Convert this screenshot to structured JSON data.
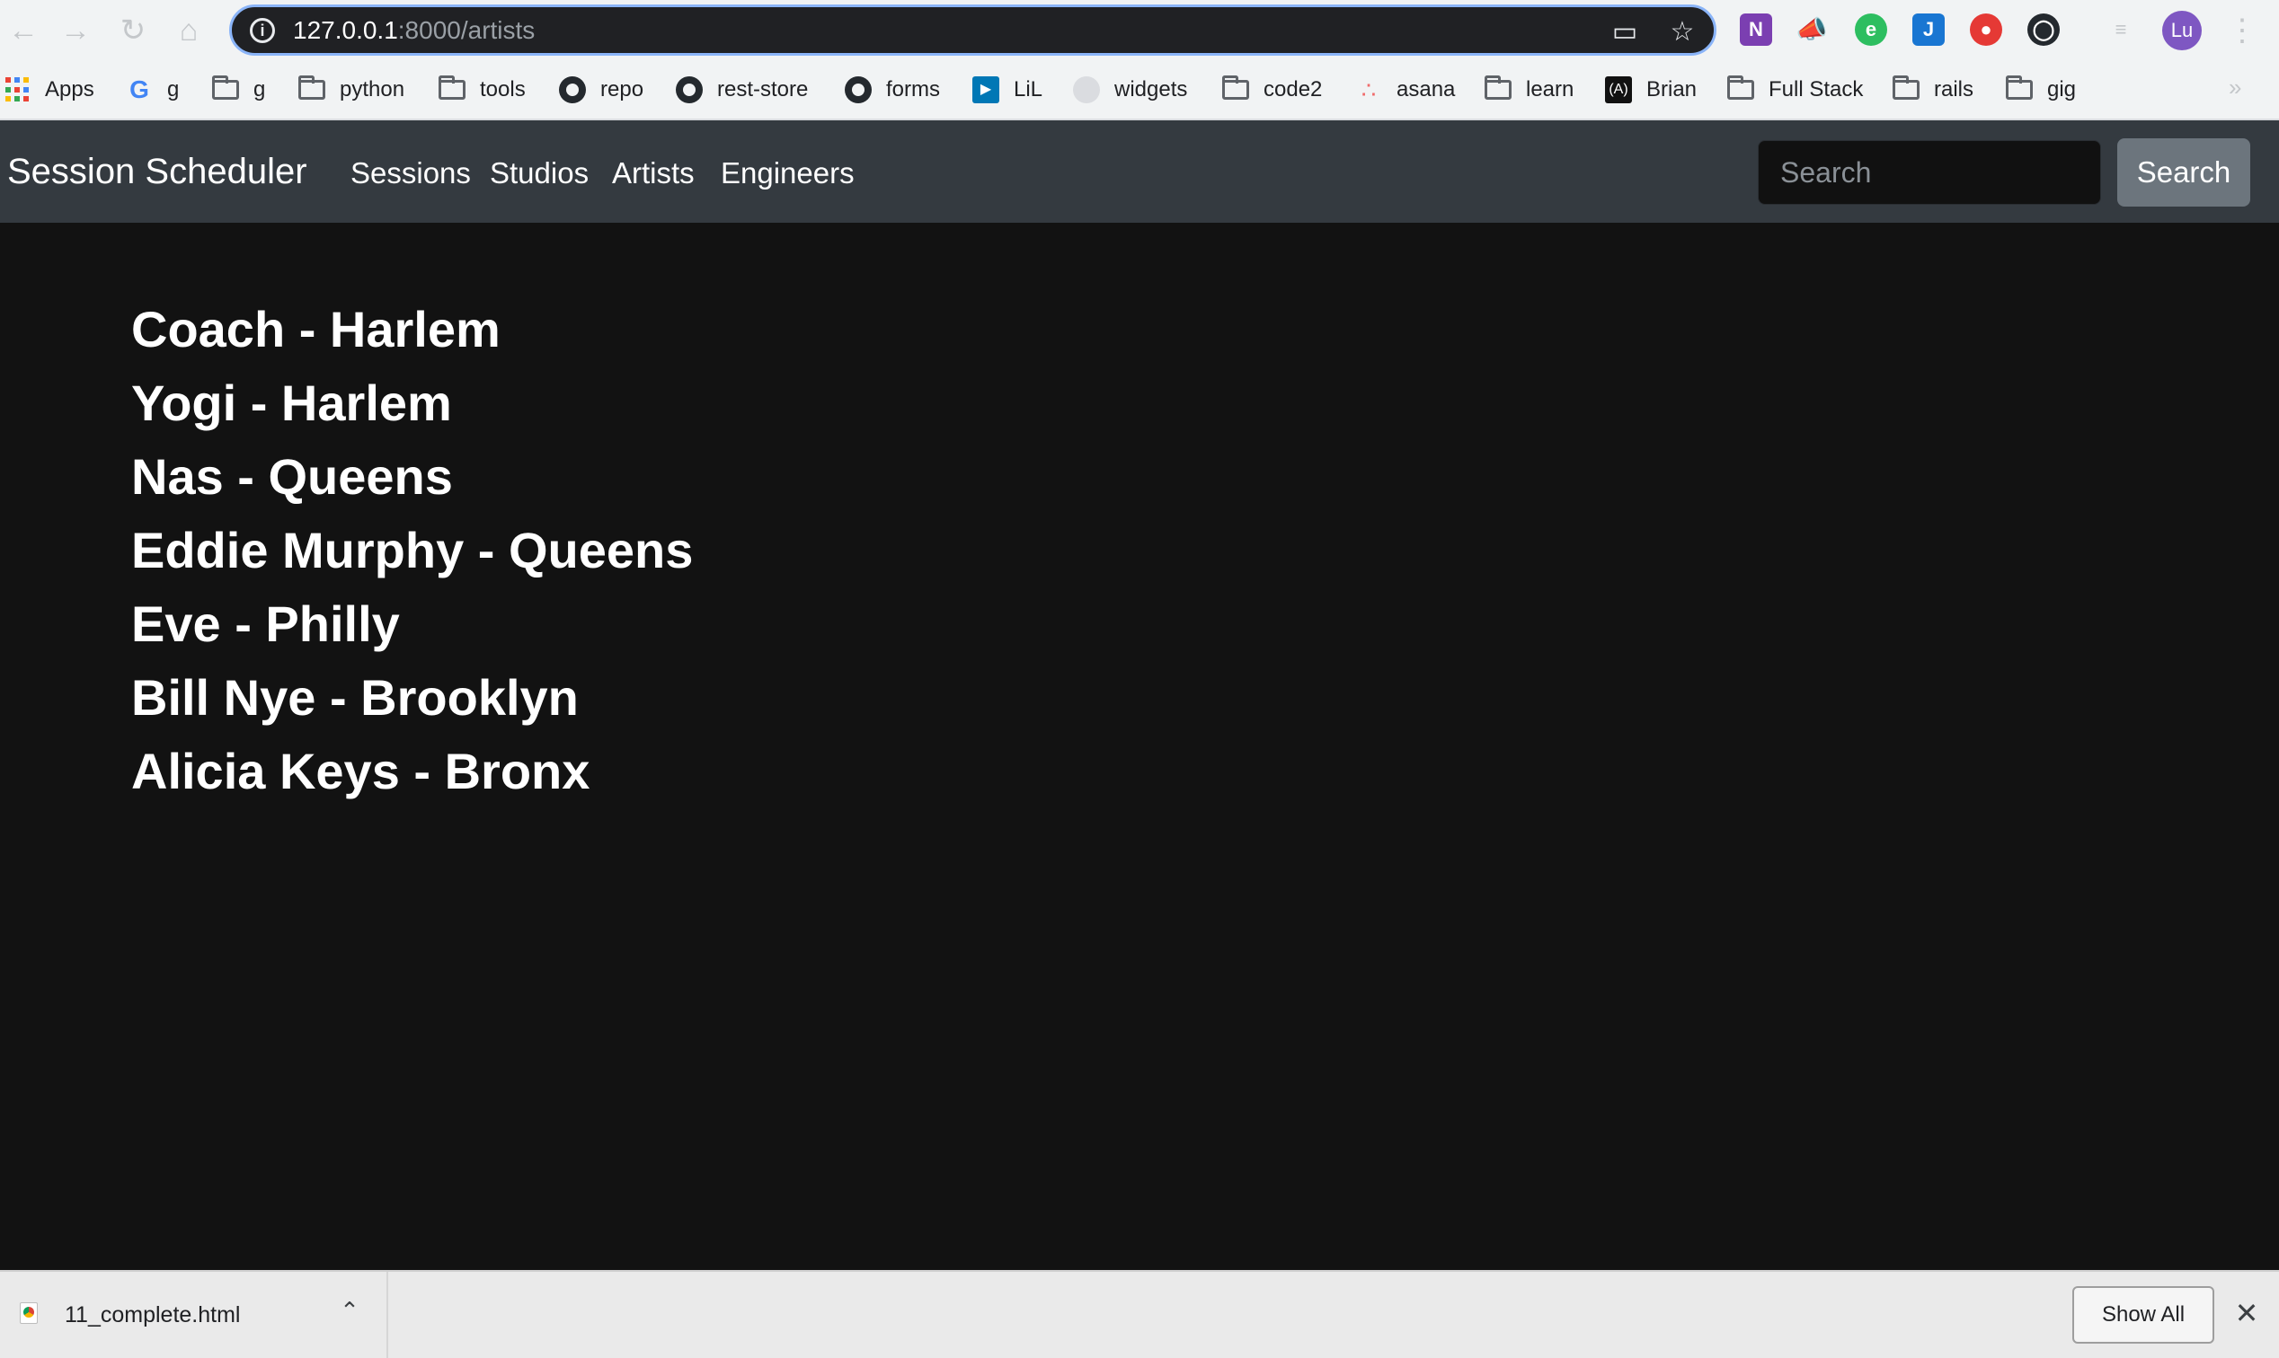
{
  "browser": {
    "url_host": "127.0.0.1",
    "url_path": ":8000/artists",
    "nav_icons": [
      "back-arrow-icon",
      "forward-arrow-icon",
      "reload-icon",
      "home-icon"
    ],
    "extensions": [
      "onenote-icon",
      "megaphone-icon",
      "evernote-icon",
      "j-extension-icon",
      "red-extension-icon",
      "github-icon",
      "media-queue-icon"
    ],
    "profile_initials": "Lu",
    "accent_color": "#8ab4f8"
  },
  "bookmarks": [
    {
      "label": "Apps",
      "icon": "apps-grid-icon"
    },
    {
      "label": "g",
      "icon": "google-icon"
    },
    {
      "label": "g",
      "icon": "folder-icon"
    },
    {
      "label": "python",
      "icon": "folder-icon"
    },
    {
      "label": "tools",
      "icon": "folder-icon"
    },
    {
      "label": "repo",
      "icon": "github-icon"
    },
    {
      "label": "rest-store",
      "icon": "github-icon"
    },
    {
      "label": "forms",
      "icon": "github-icon"
    },
    {
      "label": "LiL",
      "icon": "lil-icon"
    },
    {
      "label": "widgets",
      "icon": "globe-icon"
    },
    {
      "label": "code2",
      "icon": "folder-icon"
    },
    {
      "label": "asana",
      "icon": "asana-icon"
    },
    {
      "label": "learn",
      "icon": "folder-icon"
    },
    {
      "label": "Brian",
      "icon": "brian-icon"
    },
    {
      "label": "Full Stack",
      "icon": "folder-icon"
    },
    {
      "label": "rails",
      "icon": "folder-icon"
    },
    {
      "label": "gig",
      "icon": "folder-icon"
    }
  ],
  "navbar": {
    "brand": "Session Scheduler",
    "links": [
      "Sessions",
      "Studios",
      "Artists",
      "Engineers"
    ],
    "search_placeholder": "Search",
    "search_button": "Search",
    "background_color": "#343a40"
  },
  "artists": [
    "Coach - Harlem",
    "Yogi - Harlem",
    "Nas - Queens",
    "Eddie Murphy - Queens",
    "Eve - Philly",
    "Bill Nye - Brooklyn",
    "Alicia Keys - Bronx"
  ],
  "downloads": {
    "file_name": "11_complete.html",
    "show_all_label": "Show All"
  }
}
